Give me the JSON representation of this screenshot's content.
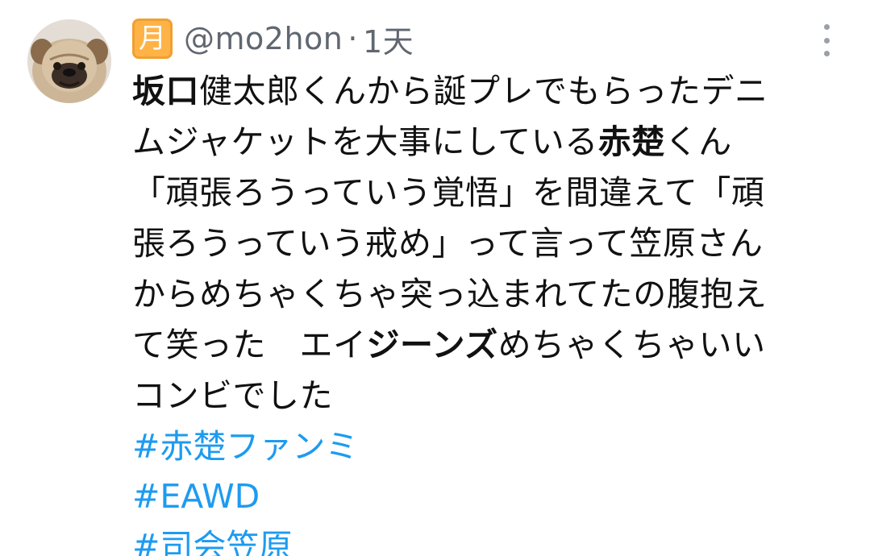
{
  "tweet": {
    "name_badge": "月",
    "handle": "@mo2hon",
    "separator": "·",
    "time": "1天",
    "lines": [
      [
        "坂口",
        "健太郎くんから誕プレでもらったデニ"
      ],
      [
        "ムジャケットを大事にしている",
        "赤楚",
        "くん"
      ],
      [
        "「頑張ろうっていう覚悟」を間違えて「頑"
      ],
      [
        "張ろうっていう戒め」って言って笠原さん"
      ],
      [
        "からめちゃくちゃ突っ込まれてたの腹抱え"
      ],
      [
        "て笑った　エイ",
        "ジーンズ",
        "めちゃくちゃいい"
      ],
      [
        "コンビでした"
      ]
    ],
    "hashtags": [
      "#赤楚ファンミ",
      "#EAWD",
      "#司会笠原"
    ]
  },
  "icons": {
    "avatar": "pug-avatar",
    "more": "more-vertical-icon"
  },
  "colors": {
    "hashtag": "#1d9bf0",
    "handle": "#606770",
    "badge": "#ffb347"
  }
}
